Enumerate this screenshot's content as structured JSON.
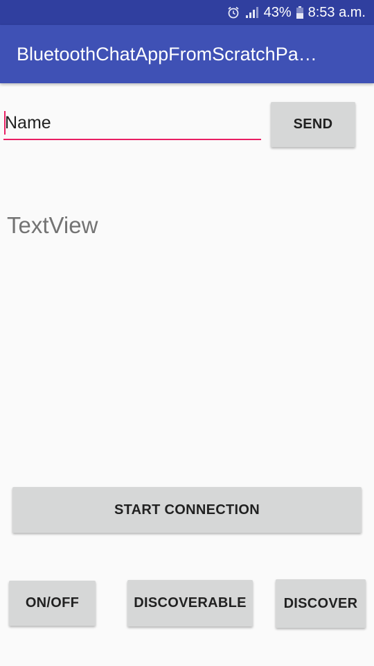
{
  "status_bar": {
    "battery_percent": "43%",
    "time": "8:53 a.m.",
    "icons": [
      "alarm-icon",
      "signal-icon",
      "battery-icon"
    ]
  },
  "app_bar": {
    "title": "BluetoothChatAppFromScratchPa…",
    "color": "#3f51b5"
  },
  "message_input": {
    "value": "Name",
    "underline_color": "#e91e63"
  },
  "buttons": {
    "send": "SEND",
    "start_connection": "START CONNECTION",
    "on_off": "ON/OFF",
    "discoverable": "DISCOVERABLE",
    "discover": "DISCOVER"
  },
  "text_view": "TextView"
}
